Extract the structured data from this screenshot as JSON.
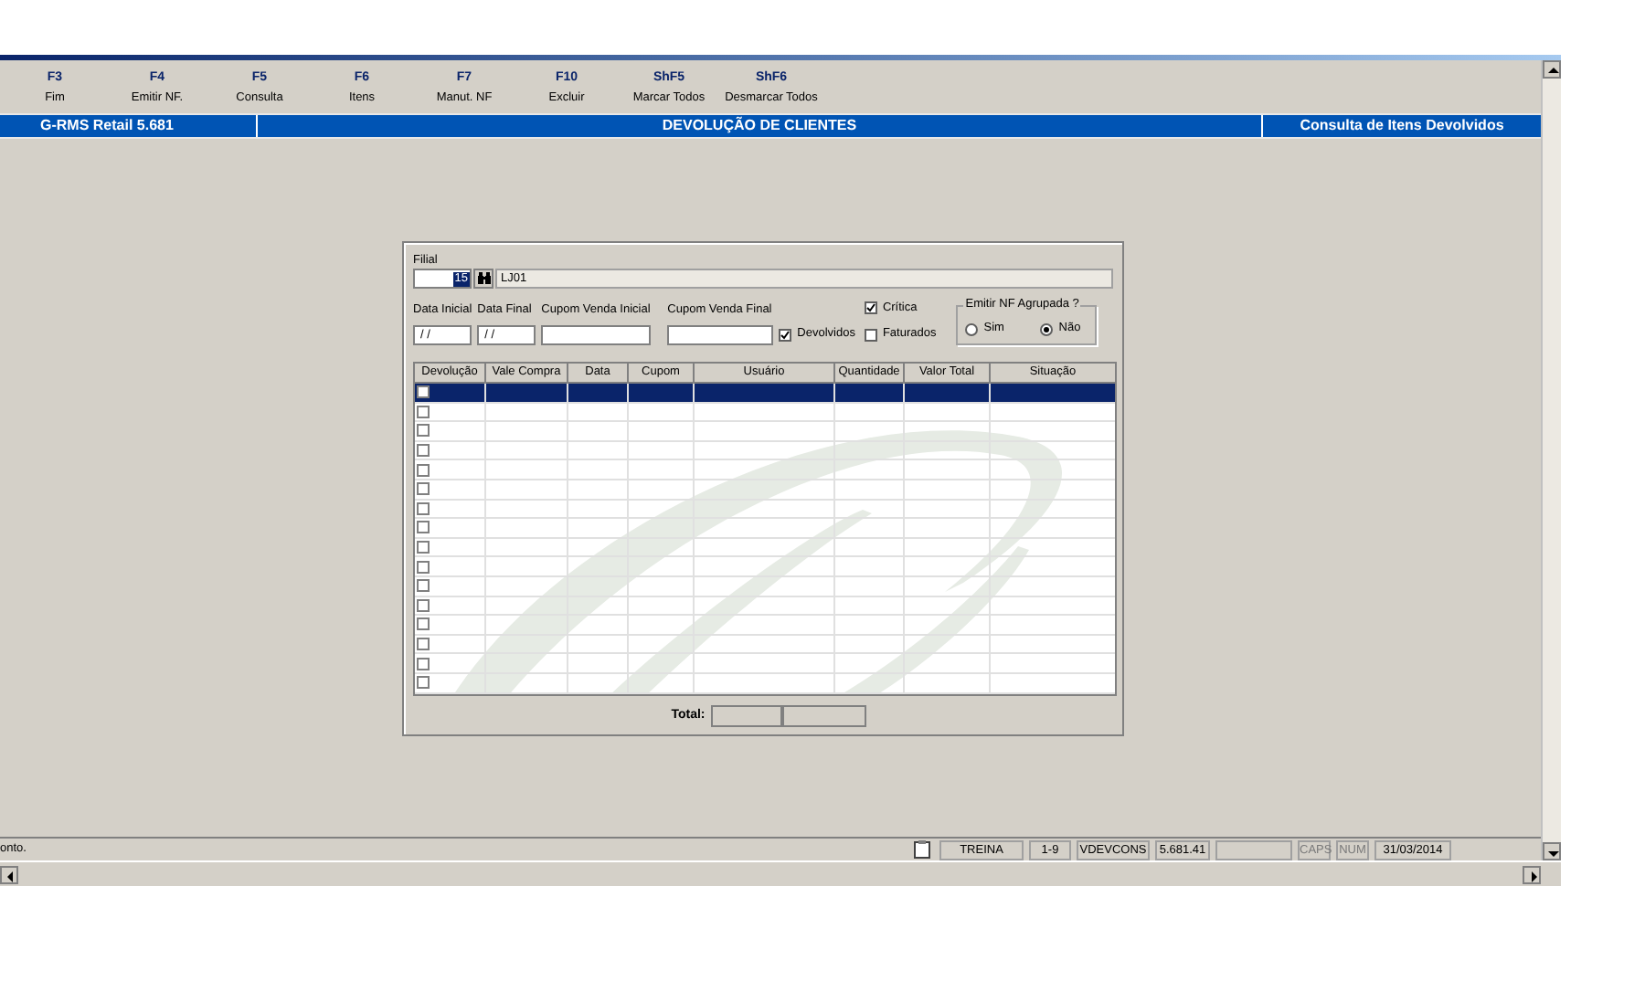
{
  "toolbar": [
    {
      "key": "F3",
      "label": "Fim"
    },
    {
      "key": "F4",
      "label": "Emitir NF."
    },
    {
      "key": "F5",
      "label": "Consulta"
    },
    {
      "key": "F6",
      "label": "Itens"
    },
    {
      "key": "F7",
      "label": "Manut. NF"
    },
    {
      "key": "F10",
      "label": "Excluir"
    },
    {
      "key": "ShF5",
      "label": "Marcar Todos"
    },
    {
      "key": "ShF6",
      "label": "Desmarcar Todos"
    }
  ],
  "header": {
    "app": "G-RMS Retail 5.681",
    "title": "DEVOLUÇÃO DE CLIENTES",
    "screen": "Consulta de Itens Devolvidos"
  },
  "form": {
    "filial": {
      "label": "Filial",
      "value": "15",
      "name": "LJ01"
    },
    "fields": [
      {
        "label": "Data Inicial",
        "value": "/ /"
      },
      {
        "label": "Data Final",
        "value": "/ /"
      },
      {
        "label": "Cupom Venda Inicial"
      },
      {
        "label": "Cupom Venda Final"
      }
    ],
    "checks": [
      {
        "label": "Devolvidos",
        "checked": true
      },
      {
        "label": "Crítica",
        "checked": true
      },
      {
        "label": "Faturados",
        "checked": false
      }
    ],
    "group": {
      "label": "Emitir NF Agrupada ?",
      "options": [
        {
          "label": "Sim",
          "selected": false
        },
        {
          "label": "Não",
          "selected": true
        }
      ]
    }
  },
  "table": {
    "columns": [
      "Devolução",
      "Vale Compra",
      "Data",
      "Cupom",
      "Usuário",
      "Quantidade",
      "Valor Total",
      "Situação"
    ],
    "rows": [
      {
        "checked": false,
        "selected": true
      },
      {
        "checked": false,
        "selected": false
      },
      {
        "checked": false,
        "selected": false
      },
      {
        "checked": false,
        "selected": false
      },
      {
        "checked": false,
        "selected": false
      },
      {
        "checked": false,
        "selected": false
      },
      {
        "checked": false,
        "selected": false
      },
      {
        "checked": false,
        "selected": false
      },
      {
        "checked": false,
        "selected": false
      },
      {
        "checked": false,
        "selected": false
      },
      {
        "checked": false,
        "selected": false
      },
      {
        "checked": false,
        "selected": false
      },
      {
        "checked": false,
        "selected": false
      },
      {
        "checked": false,
        "selected": false
      },
      {
        "checked": false,
        "selected": false
      },
      {
        "checked": false,
        "selected": false
      }
    ]
  },
  "total": {
    "label": "Total:"
  },
  "status_bar": {
    "message": "onto.",
    "panels": [
      {
        "kind": "text",
        "text": "TREINA"
      },
      {
        "kind": "text",
        "text": "1-9"
      },
      {
        "kind": "text",
        "text": "VDEVCONS"
      },
      {
        "kind": "text",
        "text": "5.681.41"
      },
      {
        "kind": "blank"
      },
      {
        "kind": "key",
        "text": "CAPS",
        "on": false
      },
      {
        "kind": "key",
        "text": "NUM",
        "on": false
      },
      {
        "kind": "text",
        "text": "31/03/2014"
      }
    ]
  }
}
